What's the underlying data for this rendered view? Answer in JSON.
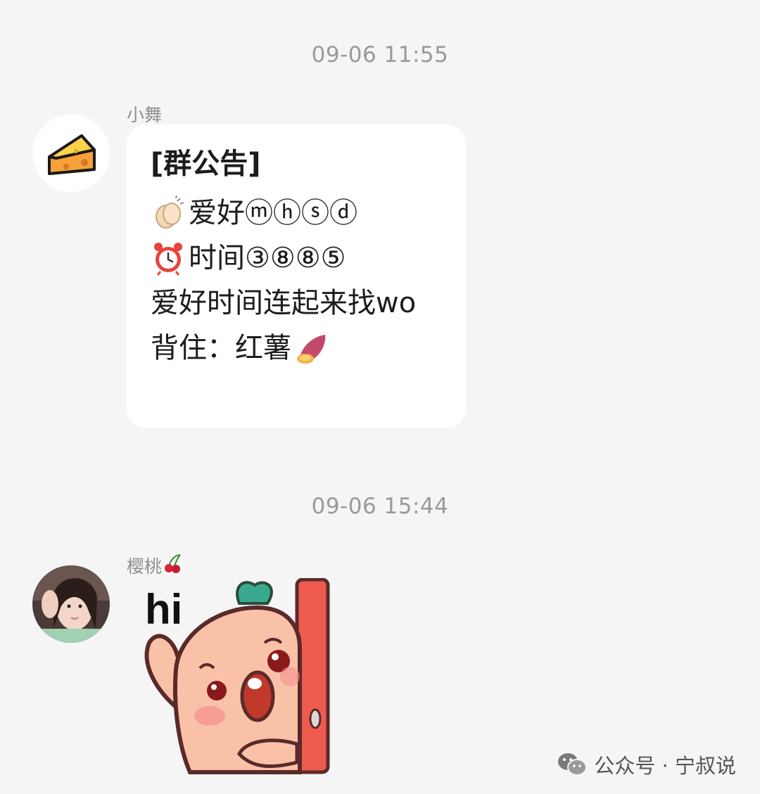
{
  "messages": [
    {
      "timestamp": "09-06 11:55",
      "sender": "小舞",
      "avatar_icon": "cheese-icon",
      "announcement": {
        "title": "[群公告]",
        "lines": [
          {
            "icon": "clapping-hands-icon",
            "text": "爱好ⓜⓗⓢⓓ"
          },
          {
            "icon": "alarm-clock-icon",
            "text": "时间③⑧⑧⑤"
          },
          {
            "icon": "",
            "text": "爱好时间连起来找wo"
          },
          {
            "icon": "sweet-potato-icon",
            "text": "背住：红薯"
          }
        ]
      }
    },
    {
      "timestamp": "09-06 15:44",
      "sender": "樱桃",
      "sender_emoji": "cherry-icon",
      "avatar_icon": "girl-photo-avatar",
      "sticker": {
        "text": "hi",
        "icon": "peach-character-waving-sticker"
      }
    }
  ],
  "watermark": {
    "text": "公众号 · 宁叔说",
    "icon": "wechat-icon"
  },
  "colors": {
    "background": "#f5f5f5",
    "bubble": "#ffffff",
    "timestamp": "#9a9a9a"
  }
}
